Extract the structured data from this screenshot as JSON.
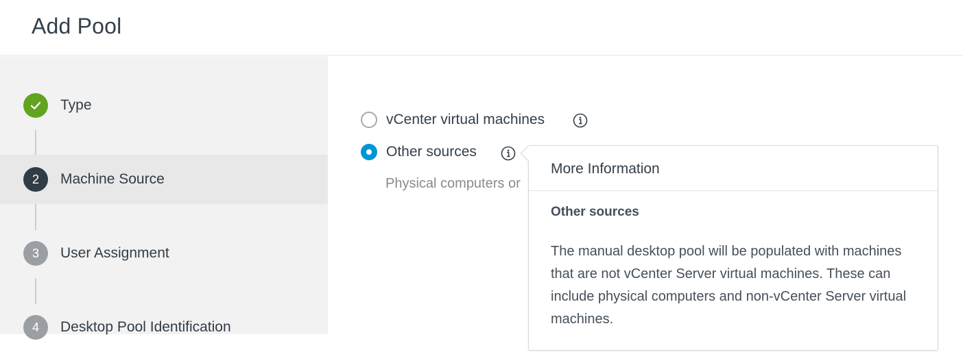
{
  "header": {
    "title": "Add Pool"
  },
  "sidebar": {
    "steps": [
      {
        "number": "",
        "label": "Type",
        "state": "done"
      },
      {
        "number": "2",
        "label": "Machine Source",
        "state": "current"
      },
      {
        "number": "3",
        "label": "User Assignment",
        "state": "todo"
      },
      {
        "number": "4",
        "label": "Desktop Pool Identification",
        "state": "todo"
      }
    ]
  },
  "main": {
    "options": [
      {
        "label": "vCenter virtual machines",
        "selected": false
      },
      {
        "label": "Other sources",
        "selected": true
      }
    ],
    "description": "Physical computers or"
  },
  "popover": {
    "title": "More Information",
    "subtitle": "Other sources",
    "body": "The manual desktop pool will be populated with machines that are not vCenter Server virtual machines. These can include physical computers and non-vCenter Server virtual machines."
  },
  "colors": {
    "accent": "#0095d3",
    "done": "#62a420",
    "current": "#313c47",
    "todo": "#9b9fa3"
  }
}
